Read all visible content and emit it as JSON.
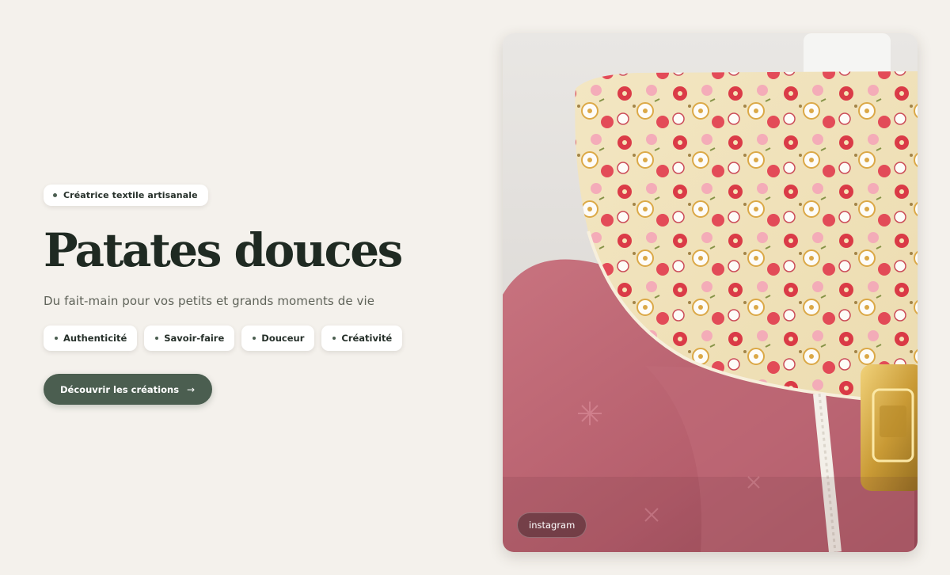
{
  "hero": {
    "eyebrow": "Créatrice textile artisanale",
    "title": "Patates douces",
    "subtitle": "Du fait-main pour vos petits et grands moments de vie",
    "values": [
      {
        "label": "Authenticité"
      },
      {
        "label": "Savoir-faire"
      },
      {
        "label": "Douceur"
      },
      {
        "label": "Créativité"
      }
    ],
    "cta_label": "Découvrir les créations",
    "cta_arrow": "→"
  },
  "photo": {
    "badge": "instagram"
  },
  "colors": {
    "background": "#f4f1ec",
    "accent": "#4b5e50",
    "title": "#1f2a22"
  }
}
